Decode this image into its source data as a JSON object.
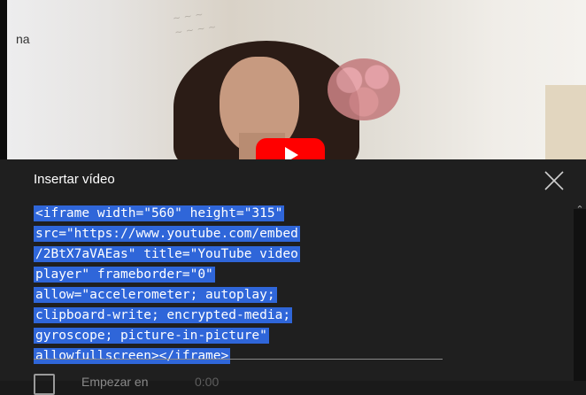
{
  "video": {
    "label_fragment": "na"
  },
  "dialog": {
    "title": "Insertar vídeo",
    "close_icon": "close-icon",
    "embed_code_lines": [
      "<iframe width=\"560\" height=\"315\"",
      "src=\"https://www.youtube.com/embed",
      "/2BtX7aVAEas\" title=\"YouTube video",
      "player\" frameborder=\"0\"",
      "allow=\"accelerometer; autoplay;",
      "clipboard-write; encrypted-media;",
      "gyroscope; picture-in-picture\"",
      "allowfullscreen></iframe>"
    ],
    "start_at_label": "Empezar en",
    "start_at_time": "0:00"
  },
  "colors": {
    "dialog_bg": "#1f1f1f",
    "selection": "#2f66d9",
    "brand_red": "#ff0000"
  }
}
